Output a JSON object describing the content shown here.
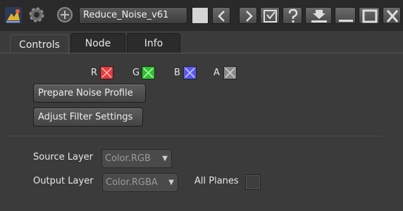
{
  "toolbar": {
    "node_name": "Reduce_Noise_v61",
    "icons": [
      "app-logo-icon",
      "gear-icon",
      "add-icon",
      "prev-icon",
      "next-icon",
      "fit-icon",
      "help-icon",
      "float-icon",
      "minimize-icon",
      "maximize-icon",
      "close-icon"
    ],
    "swatch_color": "#d4d4d4"
  },
  "tabs": [
    {
      "label": "Controls",
      "active": true
    },
    {
      "label": "Node",
      "active": false
    },
    {
      "label": "Info",
      "active": false
    }
  ],
  "channels": [
    {
      "label": "R",
      "color": "#e83a3a"
    },
    {
      "label": "G",
      "color": "#2bc42b"
    },
    {
      "label": "B",
      "color": "#5a5af0"
    },
    {
      "label": "A",
      "color": "#8a8a8a"
    }
  ],
  "buttons": {
    "prepare": "Prepare Noise Profile",
    "adjust": "Adjust Filter Settings"
  },
  "layers": {
    "source_label": "Source Layer",
    "source_value": "Color.RGB",
    "output_label": "Output Layer",
    "output_value": "Color.RGBA",
    "all_planes_label": "All Planes"
  }
}
